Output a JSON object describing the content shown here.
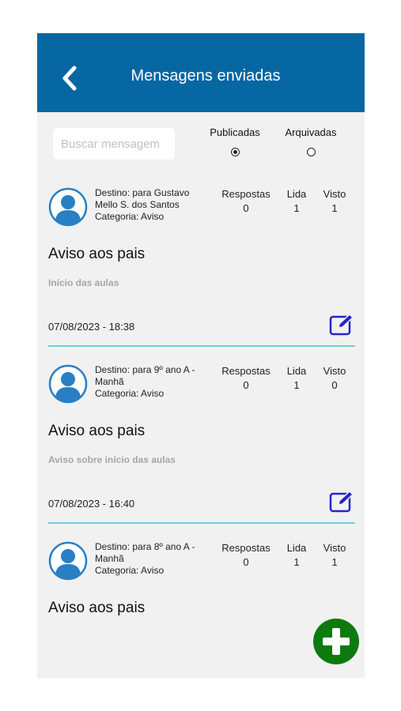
{
  "header": {
    "title": "Mensagens enviadas",
    "back_icon": "chevron-left-icon",
    "color": "#0667a3"
  },
  "search": {
    "placeholder": "Buscar mensagem",
    "value": ""
  },
  "filters": [
    {
      "label": "Publicadas",
      "selected": true
    },
    {
      "label": "Arquivadas",
      "selected": false
    }
  ],
  "stat_labels": {
    "respostas": "Respostas",
    "lida": "Lida",
    "visto": "Visto"
  },
  "messages": [
    {
      "destino": "Destino: para Gustavo Mello S. dos Santos",
      "categoria": "Categoria: Aviso",
      "respostas": "0",
      "lida": "1",
      "visto": "1",
      "title": "Aviso aos pais",
      "subtitle": "Início das aulas",
      "date": "07/08/2023 - 18:38"
    },
    {
      "destino": "Destino: para 9º ano A - Manhã",
      "categoria": "Categoria: Aviso",
      "respostas": "0",
      "lida": "1",
      "visto": "0",
      "title": "Aviso aos pais",
      "subtitle": "Aviso sobre início das aulas",
      "date": "07/08/2023 - 16:40"
    },
    {
      "destino": "Destino: para 8º ano A - Manhã",
      "categoria": "Categoria: Aviso",
      "respostas": "0",
      "lida": "1",
      "visto": "1",
      "title": "Aviso aos pais"
    }
  ],
  "icons": {
    "avatar": "user-avatar-icon",
    "edit": "edit-icon",
    "add": "plus-icon"
  },
  "colors": {
    "accent": "#0667a3",
    "edit": "#2424c8",
    "fab": "#0e7a0e",
    "divider": "#79c8d6"
  }
}
